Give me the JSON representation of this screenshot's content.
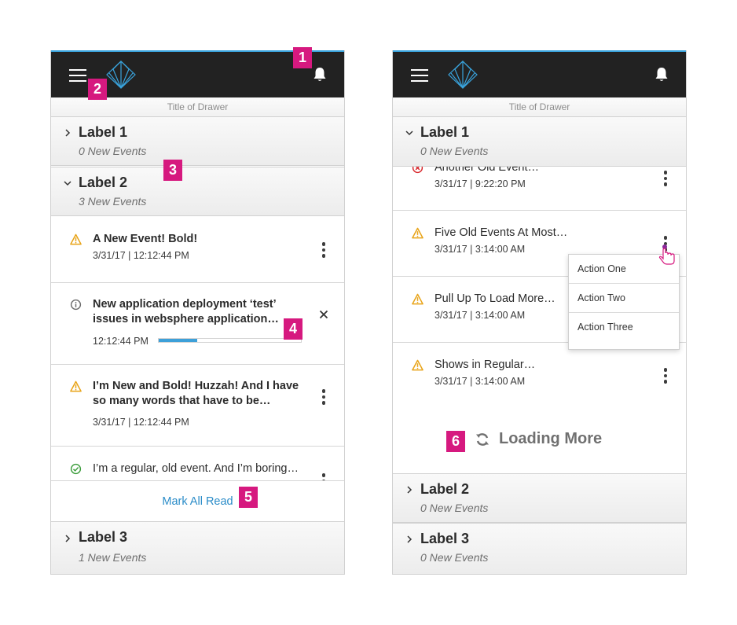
{
  "drawer_title": "Title of Drawer",
  "colors": {
    "accent": "#39a3dc",
    "callout": "#d6197f",
    "warning": "#e8a317",
    "error": "#d8262b",
    "success": "#3a9c3a",
    "link": "#2a8cc8"
  },
  "callouts": [
    "1",
    "2",
    "3",
    "4",
    "5",
    "6"
  ],
  "left_panel": {
    "groups": [
      {
        "label": "Label 1",
        "sub": "0 New Events",
        "state": "collapsed"
      },
      {
        "label": "Label 2",
        "sub": "3 New Events",
        "state": "expanded"
      },
      {
        "label": "Label 3",
        "sub": "1 New Events",
        "state": "collapsed"
      }
    ],
    "events": [
      {
        "icon": "warning-icon",
        "title": "A New Event! Bold!",
        "time": "3/31/17 | 12:12:44 PM"
      },
      {
        "icon": "info-icon",
        "title": "New application deployment ‘test’ issues in websphere application…",
        "time": "12:12:44 PM",
        "progress": 0.27
      },
      {
        "icon": "warning-icon",
        "title": "I’m New and Bold! Huzzah! And I have so many words that have to be…",
        "time": "3/31/17 | 12:12:44 PM"
      },
      {
        "icon": "success-icon",
        "title": "I’m a regular, old event. And I’m boring…"
      }
    ],
    "mark_all_read": "Mark All Read"
  },
  "right_panel": {
    "groups": [
      {
        "label": "Label 1",
        "sub": "0 New Events",
        "state": "expanded"
      },
      {
        "label": "Label 2",
        "sub": "0 New Events",
        "state": "collapsed"
      },
      {
        "label": "Label 3",
        "sub": "0 New Events",
        "state": "collapsed"
      }
    ],
    "events": [
      {
        "icon": "error-icon",
        "title": "Another Old Event…",
        "time": "3/31/17 | 9:22:20 PM"
      },
      {
        "icon": "warning-icon",
        "title": "Five Old Events At Most…",
        "time": "3/31/17 | 3:14:00 AM"
      },
      {
        "icon": "warning-icon",
        "title": "Pull Up To Load More…",
        "time": "3/31/17 | 3:14:00 AM"
      },
      {
        "icon": "warning-icon",
        "title": "Shows in Regular…",
        "time": "3/31/17 | 3:14:00 AM"
      }
    ],
    "menu": [
      "Action One",
      "Action Two",
      "Action Three"
    ],
    "loading_text": "Loading More"
  }
}
